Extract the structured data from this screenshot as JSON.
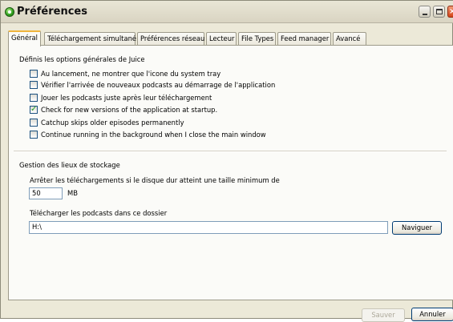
{
  "window": {
    "title": "Préférences"
  },
  "tabs": [
    {
      "label": "Général",
      "active": true
    },
    {
      "label": "Téléchargement simultané",
      "active": false
    },
    {
      "label": "Préférences réseau",
      "active": false
    },
    {
      "label": "Lecteur",
      "active": false
    },
    {
      "label": "File Types",
      "active": false
    },
    {
      "label": "Feed manager",
      "active": false
    },
    {
      "label": "Avancé",
      "active": false
    }
  ],
  "general": {
    "heading": "Définis les options générales de Juice",
    "options": [
      {
        "label": "Au lancement, ne montrer que l'icone du system tray",
        "checked": false
      },
      {
        "label": "Vérifier l'arrivée de nouveaux podcasts au démarrage de l'application",
        "checked": false
      },
      {
        "label": "Jouer les podcasts juste après leur téléchargement",
        "checked": false
      },
      {
        "label": "Check for new versions of the application at startup.",
        "checked": true
      },
      {
        "label": "Catchup skips older episodes permanently",
        "checked": false
      },
      {
        "label": "Continue running in the background when I close the main window",
        "checked": false
      }
    ]
  },
  "storage": {
    "heading": "Gestion des lieux de stockage",
    "min_size_label": "Arrêter les téléchargements si le disque dur atteint une taille minimum de",
    "min_size_value": "50",
    "min_size_unit": "MB",
    "folder_label": "Télécharger les podcasts dans ce dossier",
    "folder_value": "H:\\",
    "browse_label": "Naviguer"
  },
  "footer": {
    "save_label": "Sauver",
    "cancel_label": "Annuler"
  }
}
